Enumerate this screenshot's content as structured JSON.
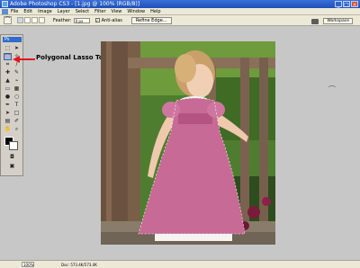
{
  "window": {
    "title": "Adobe Photoshop CS3 - [1.jpg @ 100% (RGB/8)]",
    "buttons": [
      "_",
      "□",
      "×"
    ]
  },
  "menubar": {
    "items": [
      "File",
      "Edit",
      "Image",
      "Layer",
      "Select",
      "Filter",
      "View",
      "Window",
      "Help"
    ]
  },
  "options": {
    "feather_label": "Feather:",
    "feather_value": "0 px",
    "antialias_label": "Anti-alias",
    "antialias_checked": true,
    "refine_label": "Refine Edge...",
    "workspace_label": "Workspace"
  },
  "annotation": {
    "label": "Polygonal Lasso Tool",
    "color": "#e3161c"
  },
  "tools": {
    "ps_label": "Ps",
    "items": [
      {
        "name": "marquee-tool",
        "glyph": "⬚"
      },
      {
        "name": "move-tool",
        "glyph": "➤"
      },
      {
        "name": "polygonal-lasso-tool",
        "glyph": "⌒"
      },
      {
        "name": "magic-wand-tool",
        "glyph": "✧"
      },
      {
        "name": "crop-tool",
        "glyph": "⌗"
      },
      {
        "name": "slice-tool",
        "glyph": "∕"
      },
      {
        "name": "healing-brush-tool",
        "glyph": "✚"
      },
      {
        "name": "brush-tool",
        "glyph": "✎"
      },
      {
        "name": "clone-stamp-tool",
        "glyph": "▲"
      },
      {
        "name": "history-brush-tool",
        "glyph": "⌁"
      },
      {
        "name": "eraser-tool",
        "glyph": "▭"
      },
      {
        "name": "gradient-tool",
        "glyph": "▦"
      },
      {
        "name": "blur-tool",
        "glyph": "●"
      },
      {
        "name": "dodge-tool",
        "glyph": "○"
      },
      {
        "name": "pen-tool",
        "glyph": "✒"
      },
      {
        "name": "type-tool",
        "glyph": "T"
      },
      {
        "name": "path-selection-tool",
        "glyph": "➤"
      },
      {
        "name": "shape-tool",
        "glyph": "□"
      },
      {
        "name": "notes-tool",
        "glyph": "▤"
      },
      {
        "name": "eyedropper-tool",
        "glyph": "✐"
      },
      {
        "name": "hand-tool",
        "glyph": "✋"
      },
      {
        "name": "zoom-tool",
        "glyph": "⌕"
      }
    ]
  },
  "status": {
    "zoom": "100%",
    "doc": "Doc: 573.4K/573.4K"
  }
}
